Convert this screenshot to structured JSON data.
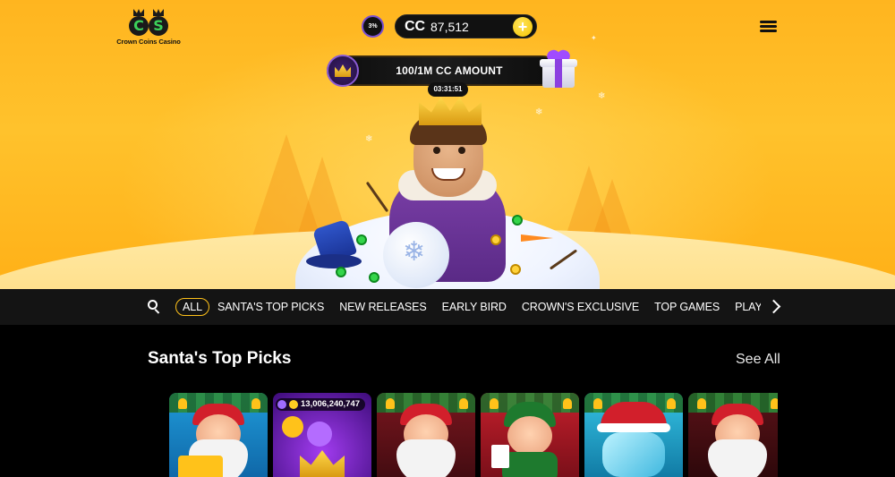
{
  "brand": {
    "logo_text": "Crown Coins Casino",
    "logo_letters": [
      "C",
      "S"
    ],
    "accent": "#ffc21a",
    "primary_green": "#3cd15a"
  },
  "header": {
    "level_badge": "3%",
    "currency_label": "CC",
    "balance": "87,512",
    "add_button": "+",
    "menu_icon": "hamburger-icon"
  },
  "promo": {
    "label": "100/1M CC AMOUNT",
    "timer": "03:31:51"
  },
  "nav": {
    "search_icon": "search-icon",
    "tabs": [
      {
        "label": "ALL",
        "active": true
      },
      {
        "label": "SANTA'S TOP PICKS"
      },
      {
        "label": "NEW RELEASES"
      },
      {
        "label": "EARLY BIRD"
      },
      {
        "label": "CROWN'S EXCLUSIVE"
      },
      {
        "label": "TOP GAMES"
      },
      {
        "label": "PLAYSON ..."
      }
    ],
    "next_icon": "chevron-right-icon"
  },
  "section": {
    "title": "Santa's Top Picks",
    "see_all": "See All",
    "cards": [
      {
        "name": "game-santa-gifts",
        "theme": "santa",
        "bg": "#1c8fd0"
      },
      {
        "name": "game-crown-jackpot",
        "theme": "jackpot",
        "bg": "#6a1fb0",
        "jackpot": "13,006,240,747"
      },
      {
        "name": "game-santa-classic",
        "theme": "santa",
        "bg": "#8a1a22"
      },
      {
        "name": "game-elf",
        "theme": "elf",
        "bg": "#b01f2a"
      },
      {
        "name": "game-frozen-tiger",
        "theme": "frozen",
        "bg": "#2bb6d9"
      },
      {
        "name": "game-santa-night",
        "theme": "santa",
        "bg": "#4a0f14"
      }
    ]
  }
}
